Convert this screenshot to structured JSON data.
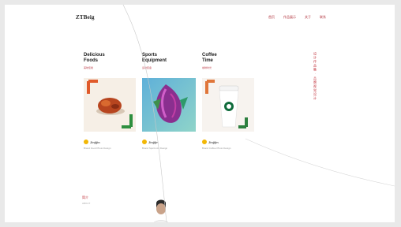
{
  "header": {
    "logo": "ZTBeig",
    "nav": [
      "首页",
      "作品展示",
      "关于",
      "联系"
    ]
  },
  "cards": [
    {
      "title_line1": "Delicious",
      "title_line2": "Foods",
      "subtitle": "美味佳肴",
      "brand": "Jinjijin",
      "caption": "Brand Food Photo Design"
    },
    {
      "title_line1": "Sports",
      "title_line2": "Equipment",
      "subtitle": "运动装备",
      "brand": "Jinjijin",
      "caption": "Brand Sports Art Design"
    },
    {
      "title_line1": "Coffee",
      "title_line2": "Time",
      "subtitle": "咖啡时光",
      "brand": "Jinjijin",
      "caption": "Brand Coffee Photo Design"
    }
  ],
  "vertical_text": "设计作品集 · 品牌视觉设计",
  "section": {
    "label": "简介",
    "sub": "ABOUT"
  },
  "colors": {
    "accent": "#c0303a",
    "brand_dot": "#f2b705",
    "background": "#ffffff"
  }
}
